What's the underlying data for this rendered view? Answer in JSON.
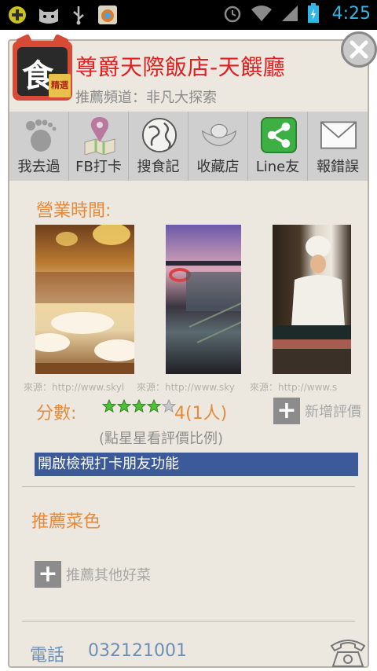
{
  "statusbar": {
    "time": "4:25"
  },
  "header": {
    "logo_char": "食",
    "logo_tag": "精選",
    "title": "尊爵天際飯店-天饌廳",
    "subtitle": "推薦頻道：非凡大探索"
  },
  "toolbar": {
    "items": [
      {
        "label": "我去過",
        "icon": "footprint-icon"
      },
      {
        "label": "FB打卡",
        "icon": "map-pin-icon"
      },
      {
        "label": "搜食記",
        "icon": "globe-icon"
      },
      {
        "label": "收藏店",
        "icon": "ingot-icon"
      },
      {
        "label": "Line友",
        "icon": "share-icon"
      },
      {
        "label": "報錯誤",
        "icon": "mail-icon"
      }
    ]
  },
  "content": {
    "hours_label": "營業時間:",
    "photo_source": [
      "來源：http://www.skyl",
      "來源：http://www.sky",
      "來源：http://www.s"
    ],
    "score_label": "分數:",
    "score_value": "4(1人)",
    "rating": 4,
    "add_review": "新增評價",
    "score_hint": "(點星星看評價比例)",
    "checkin_friends": "開啟檢視打卡朋友功能",
    "dish_label": "推薦菜色",
    "recommend_more": "推薦其他好菜",
    "phone_label": "電話",
    "phone_number": "032121001"
  },
  "colors": {
    "title": "#e02020",
    "accent_orange": "#e58a3a",
    "checkin_bar": "#3c5a9a",
    "panel_bg": "#ece8e0",
    "statusbar_accent": "#33b5e5",
    "line_green": "#3cb043"
  }
}
